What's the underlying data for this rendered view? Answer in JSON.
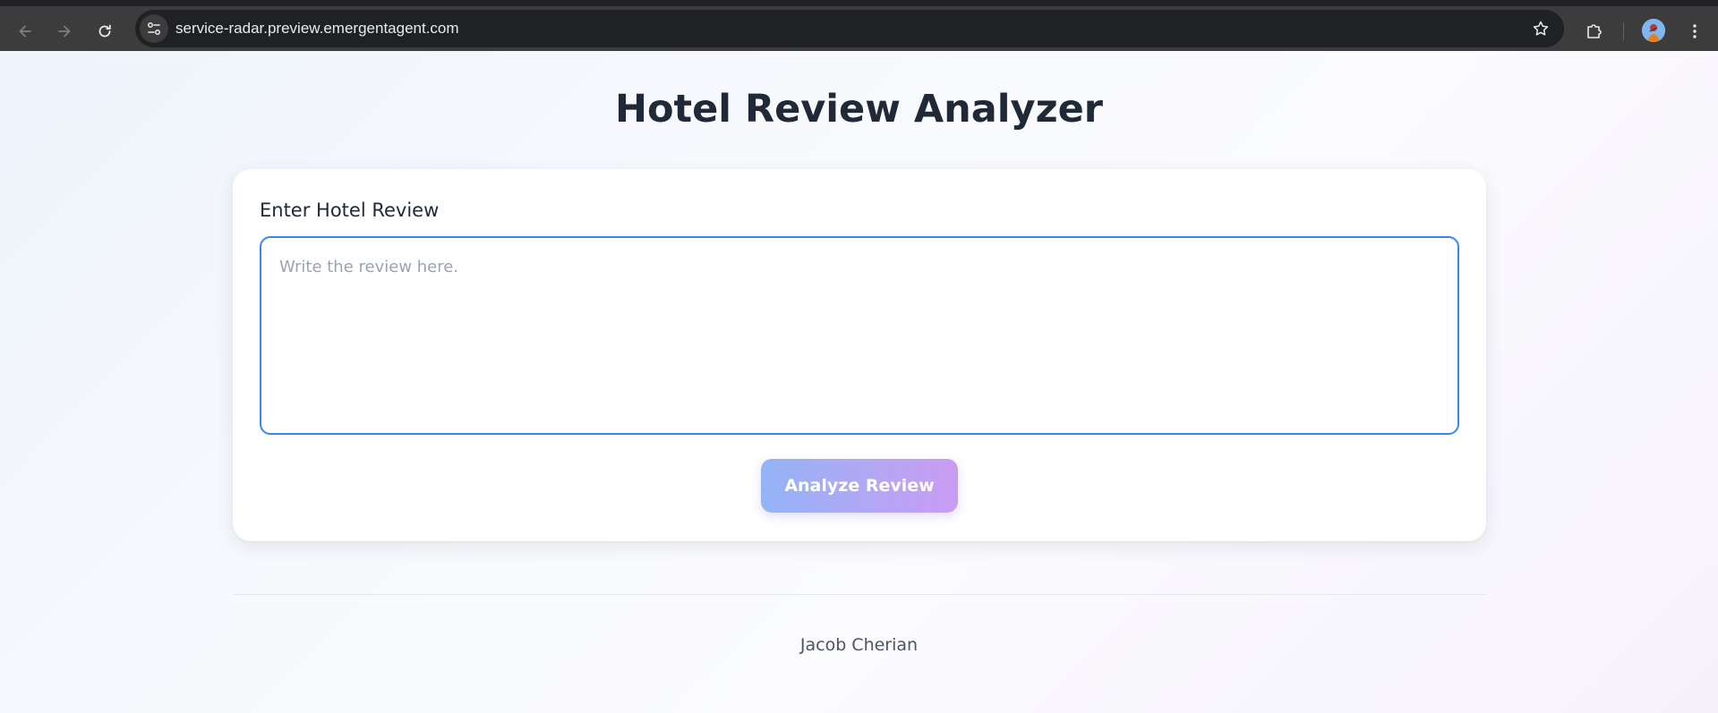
{
  "browser": {
    "url": "service-radar.preview.emergentagent.com",
    "icons": {
      "back": "arrow-left-icon",
      "forward": "arrow-right-icon",
      "reload": "reload-icon",
      "site_info": "tune-icon",
      "bookmark": "star-icon",
      "extensions": "puzzle-icon",
      "profile": "avatar-icon",
      "menu": "kebab-menu-icon"
    }
  },
  "page": {
    "title": "Hotel Review Analyzer"
  },
  "form": {
    "label": "Enter Hotel Review",
    "textarea_value": "",
    "textarea_placeholder": "Write the review here.",
    "submit_label": "Analyze Review"
  },
  "footer": {
    "author": "Jacob Cherian"
  },
  "colors": {
    "accent_border": "#3b82f6",
    "button_gradient_start": "#93b4f6",
    "button_gradient_end": "#c99cf3",
    "title_text": "#1f2937"
  }
}
